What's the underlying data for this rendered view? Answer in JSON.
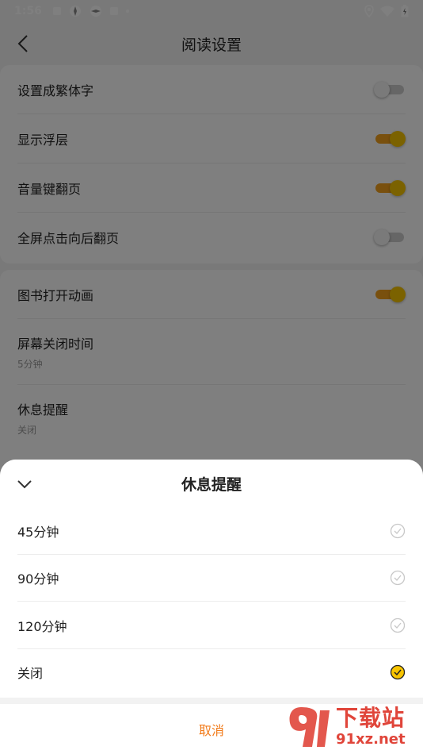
{
  "status_bar": {
    "time": "1:56"
  },
  "header": {
    "title": "阅读设置"
  },
  "settings_group1": [
    {
      "label": "设置成繁体字",
      "toggle": "off"
    },
    {
      "label": "显示浮层",
      "toggle": "on"
    },
    {
      "label": "音量键翻页",
      "toggle": "on"
    },
    {
      "label": "全屏点击向后翻页",
      "toggle": "off"
    }
  ],
  "settings_group2": {
    "book_animation": {
      "label": "图书打开动画",
      "toggle": "on"
    },
    "screen_off": {
      "label": "屏幕关闭时间",
      "value": "5分钟"
    },
    "rest_reminder": {
      "label": "休息提醒",
      "value": "关闭"
    }
  },
  "sheet": {
    "title": "休息提醒",
    "options": [
      {
        "label": "45分钟",
        "selected": false
      },
      {
        "label": "90分钟",
        "selected": false
      },
      {
        "label": "120分钟",
        "selected": false
      },
      {
        "label": "关闭",
        "selected": true
      }
    ],
    "cancel_label": "取消"
  },
  "watermark": {
    "brand": "下载站",
    "domain": "91xz.net"
  },
  "colors": {
    "accent": "#f7c400",
    "track_on": "#f3a01c",
    "cancel": "#f27b1a",
    "watermark": "#e0453a"
  }
}
